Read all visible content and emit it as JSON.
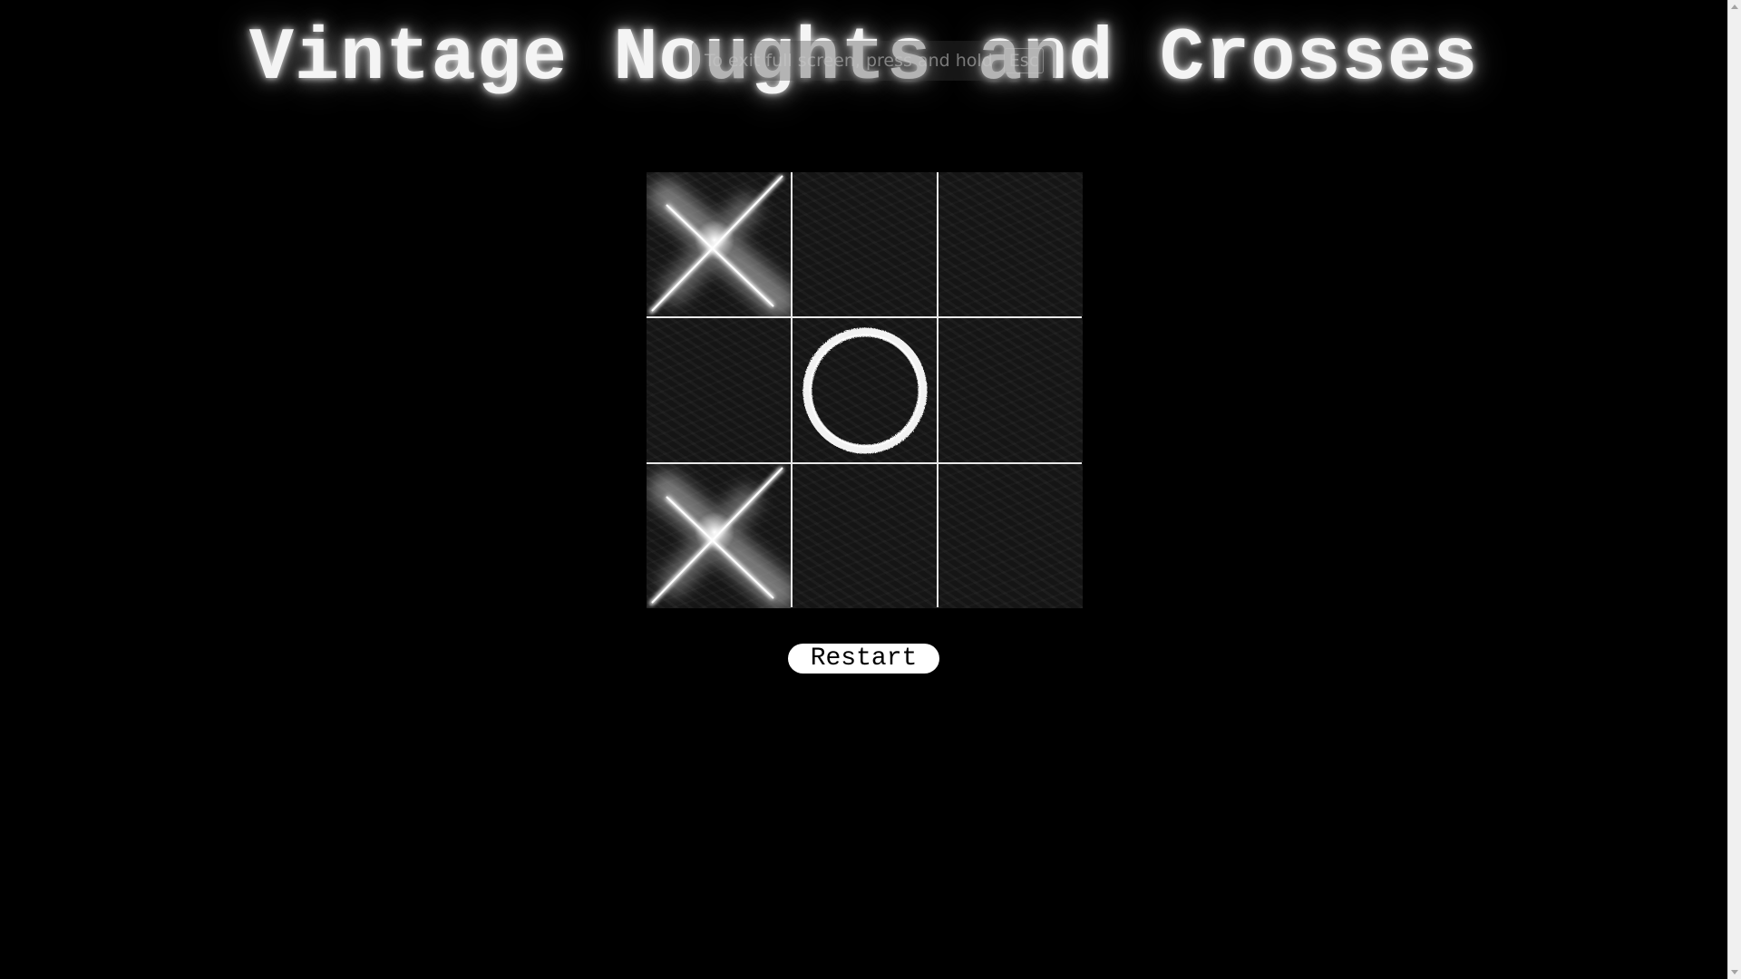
{
  "title": "Vintage Noughts and Crosses",
  "fullscreen_notice": {
    "text": "To exit full screen, press and hold",
    "key": "Esc"
  },
  "board": {
    "cells": [
      "X",
      "",
      "",
      "",
      "O",
      "",
      "X",
      "",
      ""
    ]
  },
  "restart_label": "Restart",
  "colors": {
    "background": "#000000",
    "grid_lines": "#e8e8e8",
    "cell_background": "#151515",
    "mark": "#ffffff",
    "button": "#ffffff"
  },
  "icons": {
    "x_mark": "x-mark-icon",
    "o_mark": "o-mark-icon"
  }
}
